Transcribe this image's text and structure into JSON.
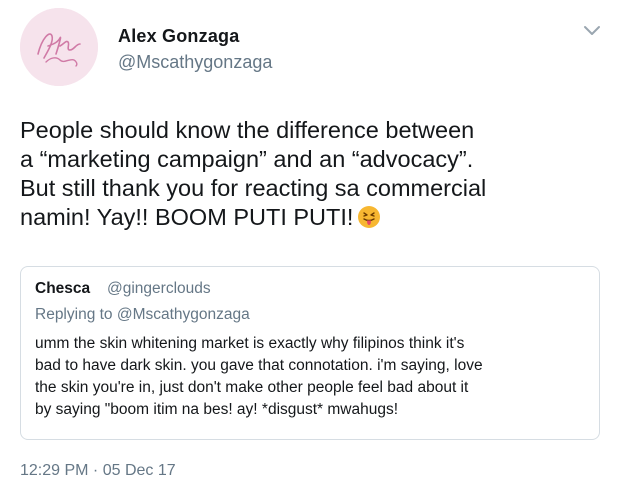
{
  "author": {
    "display_name": "Alex Gonzaga",
    "handle": "@Mscathygonzaga",
    "avatar_signature": "Alex Gonzaga"
  },
  "tweet": {
    "lines": [
      "People should know the difference between",
      "a “marketing campaign” and an “advocacy”.",
      "But still thank you for reacting sa commercial",
      "namin! Yay!! BOOM PUTI PUTI!"
    ],
    "emoji_icon": "tongue-out-emoji-icon"
  },
  "quoted": {
    "name": "Chesca",
    "handle": "@gingerclouds",
    "replying_prefix": "Replying to",
    "replying_to": "@Mscathygonzaga",
    "lines": [
      "umm the skin whitening market is exactly why filipinos think it's",
      "bad to have dark skin. you gave that connotation. i'm saying, love",
      "the skin you're in, just don't make other people feel bad about it",
      "by saying \"boom itim na bes! ay! *disgust* mwahugs!"
    ]
  },
  "timestamp": "12:29 PM · 05 Dec 17",
  "colors": {
    "text": "#14171a",
    "muted": "#657786",
    "border": "#d6dde3",
    "avatar_bg": "#f6e3ec",
    "emoji": "#f7b731"
  }
}
